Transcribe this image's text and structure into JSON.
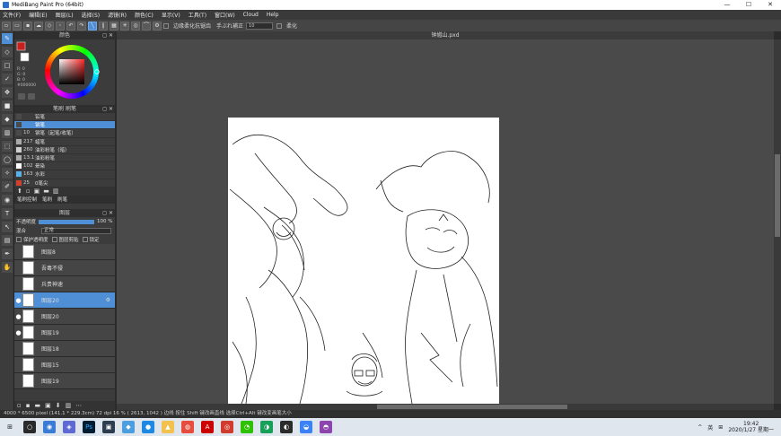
{
  "window": {
    "title": "MediBang Paint Pro (64bit)",
    "controls": [
      "—",
      "☐",
      "✕"
    ]
  },
  "menu": [
    "文件(F)",
    "编辑(E)",
    "图层(L)",
    "选择(S)",
    "滤镜(R)",
    "颜色(C)",
    "显示(V)",
    "工具(T)",
    "窗口(W)",
    "Cloud",
    "Help"
  ],
  "toolbar": {
    "opt1": "边缘柔化抗锯齿",
    "opt2": "手ぶれ補正",
    "stabilizer": "10",
    "opt3": "柔化"
  },
  "color_panel": {
    "title": "颜色",
    "primary": "#c8201d",
    "secondary": "#ffffff",
    "values": [
      "R: 0",
      "G: 0",
      "B: 0",
      "#000000"
    ]
  },
  "brush_panel": {
    "title": "笔刷  刷笔",
    "tabs": [
      "笔刷控制",
      "笔刷",
      "刷笔"
    ],
    "items": [
      {
        "num": "",
        "name": "铅笔",
        "color": "#4a4a4a"
      },
      {
        "num": "",
        "name": "钢笔",
        "color": "#4a4a4a"
      },
      {
        "num": "10",
        "name": "钢笔（起笔/收笔）",
        "color": "#4a4a4a"
      },
      {
        "num": "217",
        "name": "蜡笔",
        "color": "#aaaaaa"
      },
      {
        "num": "260",
        "name": "油彩粉笔（暗）",
        "color": "#cfcfcf"
      },
      {
        "num": "13.1",
        "name": "油彩粉笔",
        "color": "#aaaaaa"
      },
      {
        "num": "102",
        "name": "晕染",
        "color": "#ffffff"
      },
      {
        "num": "163",
        "name": "水彩",
        "color": "#5ab0e8"
      },
      {
        "num": "25",
        "name": "0笔尖",
        "color": "#d04030"
      }
    ]
  },
  "layer_panel": {
    "title": "图层",
    "opacity_label": "不透明度",
    "opacity_value": "100 %",
    "blend_label": "混合",
    "blend_value": "正常",
    "checks": [
      "保护透明度",
      "图层剪贴",
      "锁定"
    ],
    "layers": [
      {
        "name": "图层8",
        "visible": false,
        "selected": false
      },
      {
        "name": "吾毒不侵",
        "visible": false,
        "selected": false
      },
      {
        "name": "兵贵神速",
        "visible": false,
        "selected": false
      },
      {
        "name": "图层20",
        "visible": true,
        "selected": true
      },
      {
        "name": "图层20",
        "visible": true,
        "selected": false
      },
      {
        "name": "图层19",
        "visible": true,
        "selected": false
      },
      {
        "name": "图层18",
        "visible": false,
        "selected": false
      },
      {
        "name": "图层15",
        "visible": false,
        "selected": false
      },
      {
        "name": "图层19",
        "visible": false,
        "selected": false
      }
    ]
  },
  "canvas": {
    "tab_title": "钟馗山.pxd"
  },
  "status": "4000 * 6500 pixel   (141.1 * 229.3cm)   72 dpi   16 %   ( 2613, 1042 )   边线 按住 Shift 键改画直线   选择Ctrl+Alt 键改变画笔大小",
  "taskbar": {
    "tray": [
      "^",
      "英",
      "⊞"
    ],
    "time": "19:42",
    "date": "2020/1/27 星期一"
  }
}
